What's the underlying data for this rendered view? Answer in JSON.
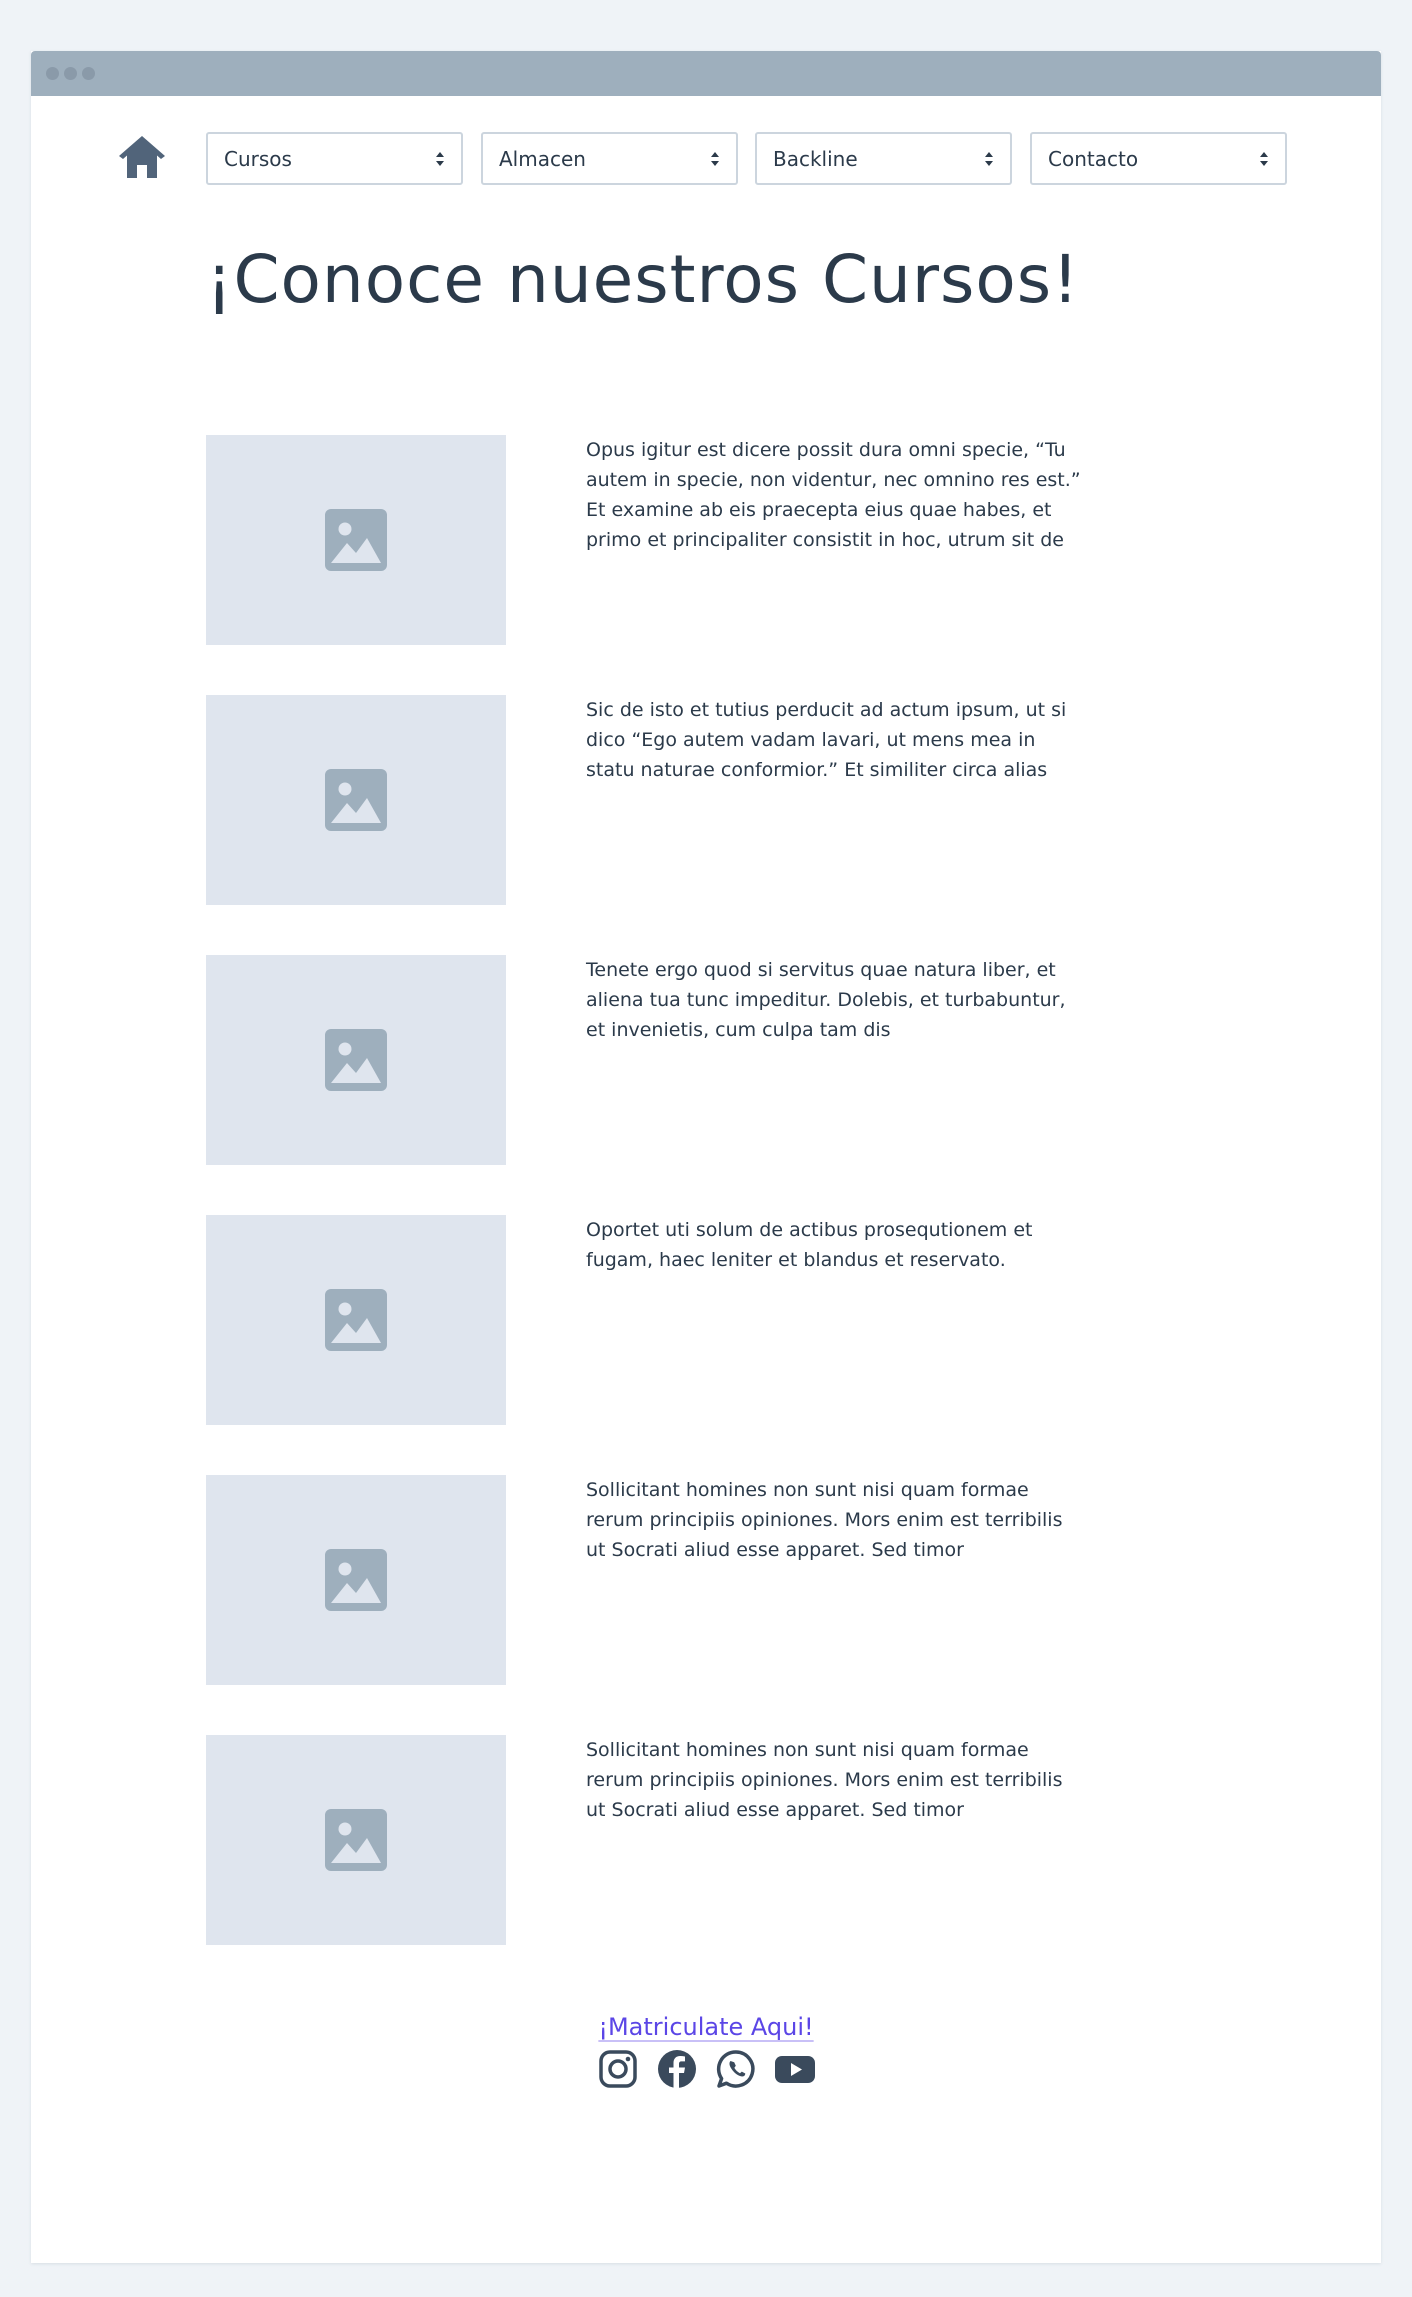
{
  "nav": {
    "home_icon": "home-icon",
    "selects": [
      "Cursos",
      "Almacen",
      "Backline",
      "Contacto"
    ]
  },
  "page": {
    "title": "¡Conoce nuestros Cursos!"
  },
  "courses": [
    {
      "image_icon": "image-placeholder-icon",
      "description": "Opus igitur est dicere possit dura omni specie, “Tu autem in specie, non videntur, nec omnino res est.” Et examine ab eis praecepta eius quae habes, et primo et principaliter consistit in hoc, utrum sit de"
    },
    {
      "image_icon": "image-placeholder-icon",
      "description": "Sic de isto et tutius perducit ad actum ipsum, ut si dico “Ego autem vadam lavari, ut mens mea in statu naturae conformior.” Et similiter circa alias"
    },
    {
      "image_icon": "image-placeholder-icon",
      "description": "Tenete ergo quod si servitus quae natura liber, et aliena tua tunc impeditur. Dolebis, et turbabuntur, et invenietis, cum culpa tam dis"
    },
    {
      "image_icon": "image-placeholder-icon",
      "description": "Oportet uti solum de actibus prosequtionem et fugam, haec leniter et blandus et reservato."
    },
    {
      "image_icon": "image-placeholder-icon",
      "description": "Sollicitant homines non sunt nisi quam formae rerum principiis opiniones. Mors enim est terribilis ut Socrati aliud esse apparet. Sed timor"
    },
    {
      "image_icon": "image-placeholder-icon",
      "description": "Sollicitant homines non sunt nisi quam formae rerum principiis opiniones. Mors enim est terribilis ut Socrati aliud esse apparet. Sed timor"
    }
  ],
  "footer": {
    "enroll_link": "¡Matriculate Aqui!",
    "social_icons": [
      "instagram-icon",
      "facebook-icon",
      "whatsapp-icon",
      "youtube-icon"
    ]
  },
  "colors": {
    "background": "#eff3f7",
    "titlebar": "#9eafbd",
    "text": "#2b3a4a",
    "placeholder": "#dfe5ee",
    "link": "#5b46e6"
  }
}
